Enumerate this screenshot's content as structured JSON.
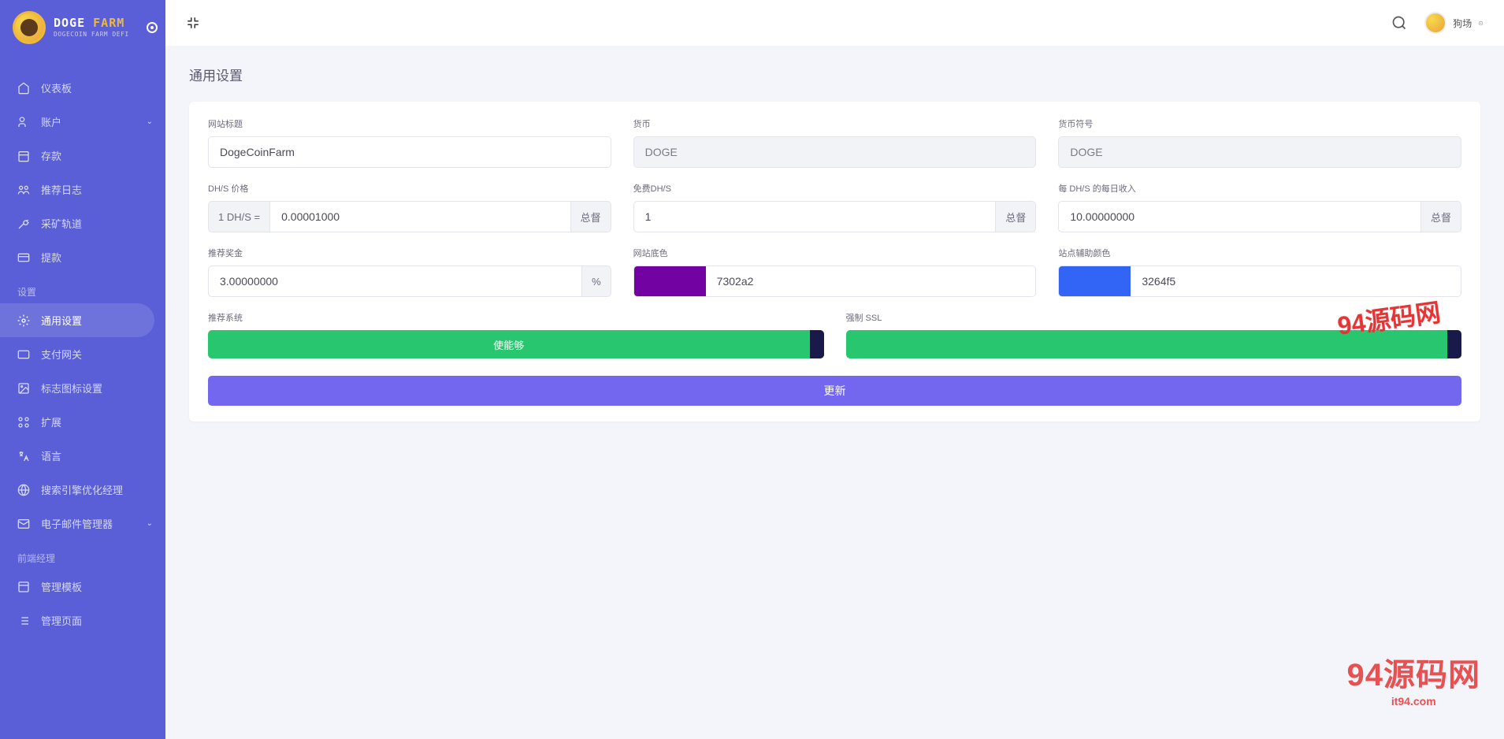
{
  "brand": {
    "title_a": "DOGE",
    "title_b": "FARM",
    "subtitle": "DOGECOIN FARM DEFI"
  },
  "topbar": {
    "username": "狗场"
  },
  "nav": {
    "items": [
      {
        "label": "仪表板",
        "icon": "home"
      },
      {
        "label": "账户",
        "icon": "users",
        "expandable": true
      },
      {
        "label": "存款",
        "icon": "calendar"
      },
      {
        "label": "推荐日志",
        "icon": "people"
      },
      {
        "label": "采矿轨道",
        "icon": "wrench"
      },
      {
        "label": "提款",
        "icon": "card"
      }
    ],
    "section_settings": "设置",
    "settings_items": [
      {
        "label": "通用设置",
        "icon": "gear",
        "active": true
      },
      {
        "label": "支付网关",
        "icon": "card2"
      },
      {
        "label": "标志图标设置",
        "icon": "image"
      },
      {
        "label": "扩展",
        "icon": "nodes"
      },
      {
        "label": "语言",
        "icon": "lang"
      },
      {
        "label": "搜索引擎优化经理",
        "icon": "globe"
      },
      {
        "label": "电子邮件管理器",
        "icon": "mail",
        "expandable": true
      }
    ],
    "section_frontend": "前端经理",
    "frontend_items": [
      {
        "label": "管理模板",
        "icon": "template"
      },
      {
        "label": "管理页面",
        "icon": "list"
      }
    ]
  },
  "page": {
    "title": "通用设置"
  },
  "form": {
    "site_title": {
      "label": "网站标题",
      "value": "DogeCoinFarm"
    },
    "currency": {
      "label": "货币",
      "value": "DOGE"
    },
    "currency_symbol": {
      "label": "货币符号",
      "value": "DOGE"
    },
    "dhs_price": {
      "label": "DH/S 价格",
      "prefix": "1 DH/S =",
      "value": "0.00001000",
      "suffix": "总督"
    },
    "free_dhs": {
      "label": "免费DH/S",
      "value": "1",
      "suffix": "总督"
    },
    "daily_income": {
      "label": "每 DH/S 的每日收入",
      "value": "10.00000000",
      "suffix": "总督"
    },
    "ref_bonus": {
      "label": "推荐奖金",
      "value": "3.00000000",
      "suffix": "%"
    },
    "base_color": {
      "label": "网站底色",
      "swatch": "#7302a2",
      "value": "7302a2"
    },
    "secondary_color": {
      "label": "站点辅助颜色",
      "swatch": "#3264f5",
      "value": "3264f5"
    },
    "ref_system": {
      "label": "推荐系统",
      "toggle_label": "使能够"
    },
    "force_ssl": {
      "label": "强制 SSL",
      "toggle_label": ""
    },
    "update_btn": "更新"
  },
  "watermark": {
    "main": "94源码网",
    "sub": "it94.com",
    "top": "94源码网"
  }
}
